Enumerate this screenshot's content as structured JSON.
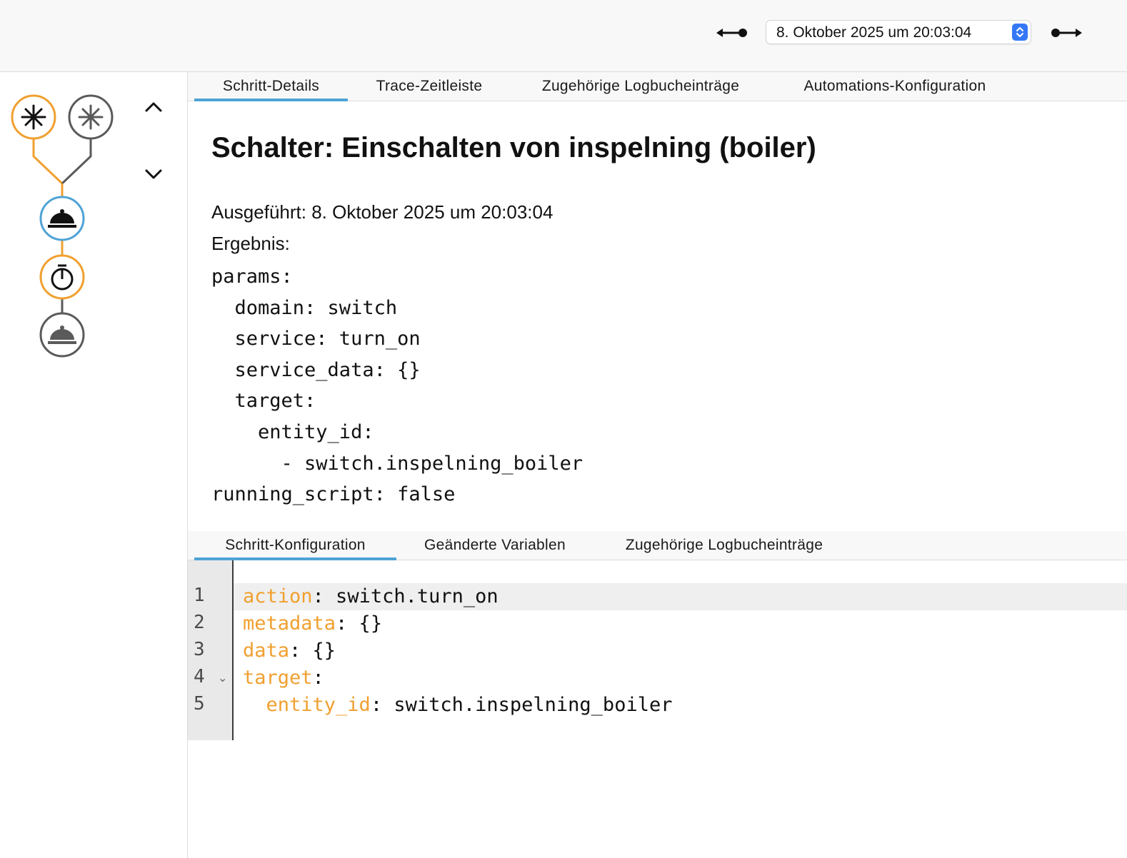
{
  "header": {
    "prev_label": "Vorheriger Trace",
    "next_label": "Nächster Trace",
    "run_selector": "8. Oktober 2025 um 20:03:04"
  },
  "graph": {
    "nodes": [
      {
        "id": "trigger-1",
        "icon": "asterisk-icon",
        "state": "active",
        "color": "#f0a030"
      },
      {
        "id": "trigger-2",
        "icon": "asterisk-icon",
        "state": "inactive",
        "color": "#5a5a5a"
      },
      {
        "id": "action-switch",
        "icon": "service-bell-icon",
        "state": "selected",
        "color": "#4fa3d6"
      },
      {
        "id": "delay",
        "icon": "timer-icon",
        "state": "active",
        "color": "#f0a030"
      },
      {
        "id": "action-switch-2",
        "icon": "service-bell-icon",
        "state": "inactive",
        "color": "#5a5a5a"
      }
    ]
  },
  "tabs_top": [
    "Schritt-Details",
    "Trace-Zeitleiste",
    "Zugehörige Logbucheinträge",
    "Automations-Konfiguration"
  ],
  "step": {
    "title": "Schalter: Einschalten von inspelning (boiler)",
    "executed": "Ausgeführt: 8. Oktober 2025 um 20:03:04",
    "result_label": "Ergebnis:",
    "result_yaml": [
      "params:",
      "  domain: switch",
      "  service: turn_on",
      "  service_data: {}",
      "  target:",
      "    entity_id:",
      "      - switch.inspelning_boiler",
      "running_script: false"
    ]
  },
  "tabs_bottom": [
    "Schritt-Konfiguration",
    "Geänderte Variablen",
    "Zugehörige Logbucheinträge"
  ],
  "editor": {
    "lines": [
      {
        "num": "1",
        "indent": "",
        "key": "action",
        "value": ": switch.turn_on"
      },
      {
        "num": "2",
        "indent": "",
        "key": "metadata",
        "value": ": {}"
      },
      {
        "num": "3",
        "indent": "",
        "key": "data",
        "value": ": {}"
      },
      {
        "num": "4",
        "indent": "",
        "key": "target",
        "value": ":"
      },
      {
        "num": "5",
        "indent": "  ",
        "key": "entity_id",
        "value": ": switch.inspelning_boiler"
      }
    ],
    "fold_marker": "⌄"
  },
  "colors": {
    "accent": "#4fa3d6",
    "orange": "#f0a030",
    "inactive": "#5a5a5a",
    "select_stepper": "#3478f6"
  }
}
